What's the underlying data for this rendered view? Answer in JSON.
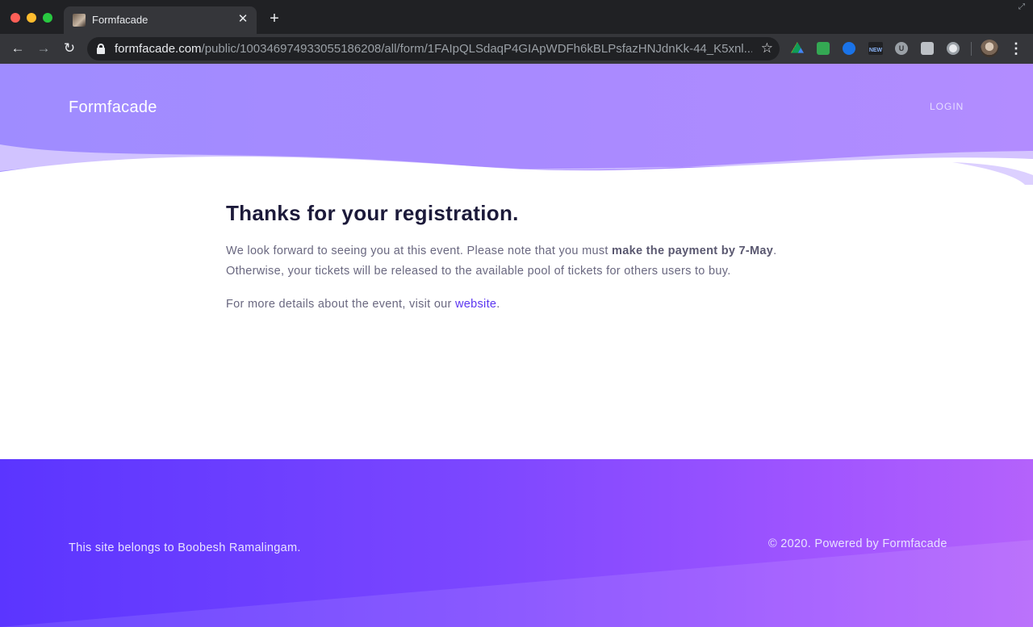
{
  "browser": {
    "tab_title": "Formfacade",
    "url_host": "formfacade.com",
    "url_path": "/public/100346974933055186208/all/form/1FAIpQLSdaqP4GIApWDFh6kBLPsfazHNJdnKk-44_K5xnl...",
    "new_badge": "NEW",
    "ext_u_label": "U"
  },
  "icons": {
    "back": "arrow-left",
    "forward": "arrow-right",
    "reload": "reload",
    "star": "star-outline",
    "close": "close",
    "plus": "plus",
    "menu": "vertical-dots"
  },
  "header": {
    "brand": "Formfacade",
    "login": "LOGIN"
  },
  "main": {
    "heading": "Thanks for your registration.",
    "para1_before": "We look forward to seeing you at this event. Please note that you must ",
    "para1_bold": "make the payment by 7-May",
    "para1_after": ". Otherwise, your tickets will be released to the available pool of tickets for others users to buy.",
    "para2_before": "For more details about the event, visit our ",
    "para2_link": "website",
    "para2_after": "."
  },
  "footer": {
    "owner_text": "This site belongs to Boobesh Ramalingam.",
    "copyright": "© 2020. Powered by Formfacade"
  },
  "colors": {
    "hero_start": "#9f8cff",
    "hero_end": "#b28cff",
    "footer_start": "#5b35ff",
    "footer_end": "#b462fb",
    "link": "#5b35f0",
    "heading": "#1c1a3a"
  }
}
